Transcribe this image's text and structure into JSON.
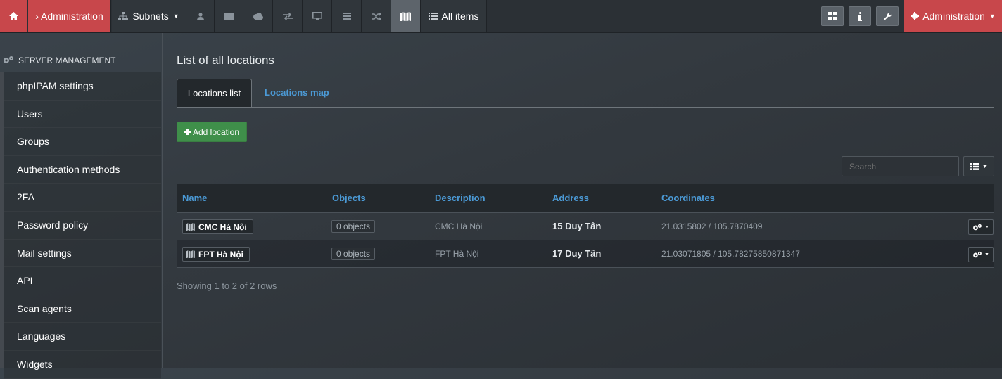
{
  "nav": {
    "admin_crumb": "› Administration",
    "subnets_label": "Subnets",
    "all_items_label": "All items",
    "admin_menu_label": "Administration"
  },
  "sidebar": {
    "header": "SERVER MANAGEMENT",
    "items": [
      {
        "label": "phpIPAM settings"
      },
      {
        "label": "Users"
      },
      {
        "label": "Groups"
      },
      {
        "label": "Authentication methods"
      },
      {
        "label": "2FA"
      },
      {
        "label": "Password policy"
      },
      {
        "label": "Mail settings"
      },
      {
        "label": "API"
      },
      {
        "label": "Scan agents"
      },
      {
        "label": "Languages"
      },
      {
        "label": "Widgets"
      }
    ]
  },
  "main": {
    "title": "List of all locations",
    "tabs": [
      {
        "label": "Locations list"
      },
      {
        "label": "Locations map"
      }
    ],
    "add_label": "Add location",
    "search_placeholder": "Search",
    "columns": [
      "Name",
      "Objects",
      "Description",
      "Address",
      "Coordinates"
    ],
    "rows": [
      {
        "name": "CMC Hà Nội",
        "objects": "0 objects",
        "description": "CMC Hà Nội",
        "address": "15 Duy Tân",
        "coordinates": "21.0315802 / 105.7870409"
      },
      {
        "name": "FPT Hà Nội",
        "objects": "0 objects",
        "description": "FPT Hà Nội",
        "address": "17 Duy Tân",
        "coordinates": "21.03071805 / 105.78275850871347"
      }
    ],
    "footer": "Showing 1 to 2 of 2 rows"
  },
  "colors": {
    "red": "#c8474b",
    "green": "#3f8f4a",
    "link": "#4b9ad6"
  }
}
